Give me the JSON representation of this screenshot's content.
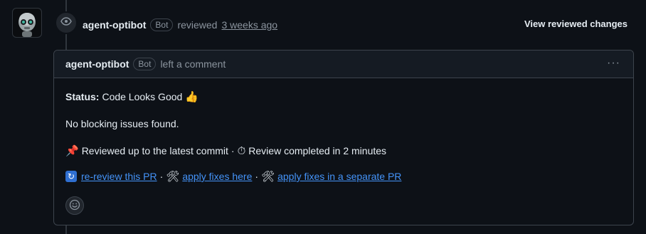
{
  "review": {
    "author": "agent-optibot",
    "badge": "Bot",
    "action": "reviewed",
    "time": "3 weeks ago",
    "view_changes": "View reviewed changes"
  },
  "comment": {
    "author": "agent-optibot",
    "badge": "Bot",
    "action": "left a comment",
    "menu": "···",
    "status_label": "Status:",
    "status_value": "Code Looks Good",
    "status_emoji": "👍",
    "no_blocking": "No blocking issues found.",
    "pin_emoji": "📌",
    "reviewed_text": "Reviewed up to the latest commit",
    "sep": "·",
    "timer_emoji": "⏱",
    "completed_text": "Review completed in 2 minutes",
    "refresh_glyph": "↻",
    "rereview_link": "re-review this PR",
    "tools_emoji": "🛠",
    "apply_here_link": "apply fixes here",
    "apply_separate_link": "apply fixes in a separate PR"
  },
  "icons": {
    "eye": "eye-icon",
    "smiley": "smiley-icon"
  },
  "colors": {
    "background": "#0d1117",
    "link": "#4493f8",
    "muted": "#8b949e"
  }
}
